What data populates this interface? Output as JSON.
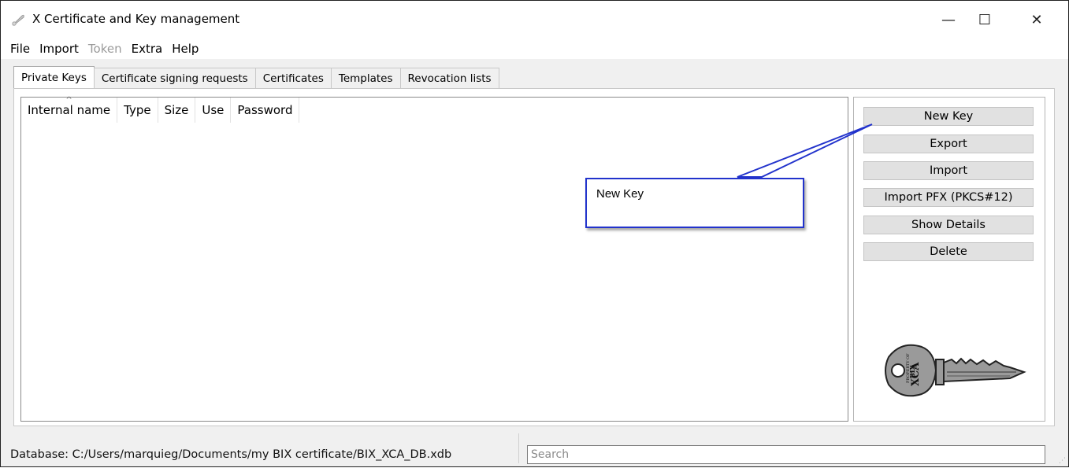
{
  "window": {
    "title": "X Certificate and Key management",
    "controls": {
      "minimize": "—",
      "maximize": "☐",
      "close": "✕"
    }
  },
  "menu": [
    {
      "label": "File",
      "enabled": true
    },
    {
      "label": "Import",
      "enabled": true
    },
    {
      "label": "Token",
      "enabled": false
    },
    {
      "label": "Extra",
      "enabled": true
    },
    {
      "label": "Help",
      "enabled": true
    }
  ],
  "tabs": [
    {
      "label": "Private Keys",
      "active": true
    },
    {
      "label": "Certificate signing requests",
      "active": false
    },
    {
      "label": "Certificates",
      "active": false
    },
    {
      "label": "Templates",
      "active": false
    },
    {
      "label": "Revocation lists",
      "active": false
    }
  ],
  "list": {
    "columns": [
      "Internal name",
      "Type",
      "Size",
      "Use",
      "Password"
    ],
    "sort_indicator": "^",
    "rows": []
  },
  "actions": {
    "new_key": "New Key",
    "export": "Export",
    "import": "Import",
    "import_pfx": "Import PFX (PKCS#12)",
    "show_details": "Show Details",
    "delete": "Delete"
  },
  "callout": {
    "text": "New Key",
    "color": "#2233cc"
  },
  "key_image": {
    "text": "XCA",
    "subtext": "PROPERTY OF",
    "brand": "BIX"
  },
  "status": {
    "database": "Database: C:/Users/marquieg/Documents/my BIX certificate/BIX_XCA_DB.xdb"
  },
  "search": {
    "placeholder": "Search",
    "value": ""
  },
  "icons": {
    "app": "feather-key-icon",
    "grip": "resize-grip-icon"
  }
}
